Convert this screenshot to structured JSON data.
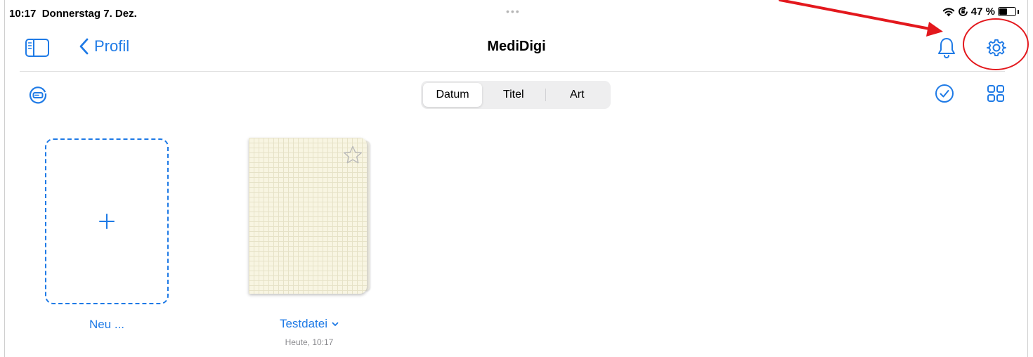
{
  "status_bar": {
    "time": "10:17",
    "date": "Donnerstag 7. Dez.",
    "multitask_dots": "•••",
    "battery_percent": "47 %",
    "battery_level": 0.47,
    "icons": [
      "wifi-icon",
      "orientation-lock-icon",
      "battery-icon"
    ]
  },
  "nav": {
    "back_label": "Profil",
    "title": "MediDigi",
    "icons": [
      "sidebar-icon",
      "chevron-left-icon",
      "bell-icon",
      "gear-icon"
    ]
  },
  "toolbar": {
    "sort_tabs": [
      {
        "label": "Datum",
        "active": true
      },
      {
        "label": "Titel",
        "active": false
      },
      {
        "label": "Art",
        "active": false
      }
    ],
    "icons": [
      "drive-icon",
      "checkmark-circle-icon",
      "grid-icon"
    ]
  },
  "documents": {
    "new_label": "Neu ...",
    "items": [
      {
        "title": "Testdatei",
        "date": "Heute, 10:17"
      }
    ]
  },
  "colors": {
    "accent": "#1e7ae6",
    "annotation": "#e3181d",
    "secondary_text": "#8a8a8e"
  }
}
